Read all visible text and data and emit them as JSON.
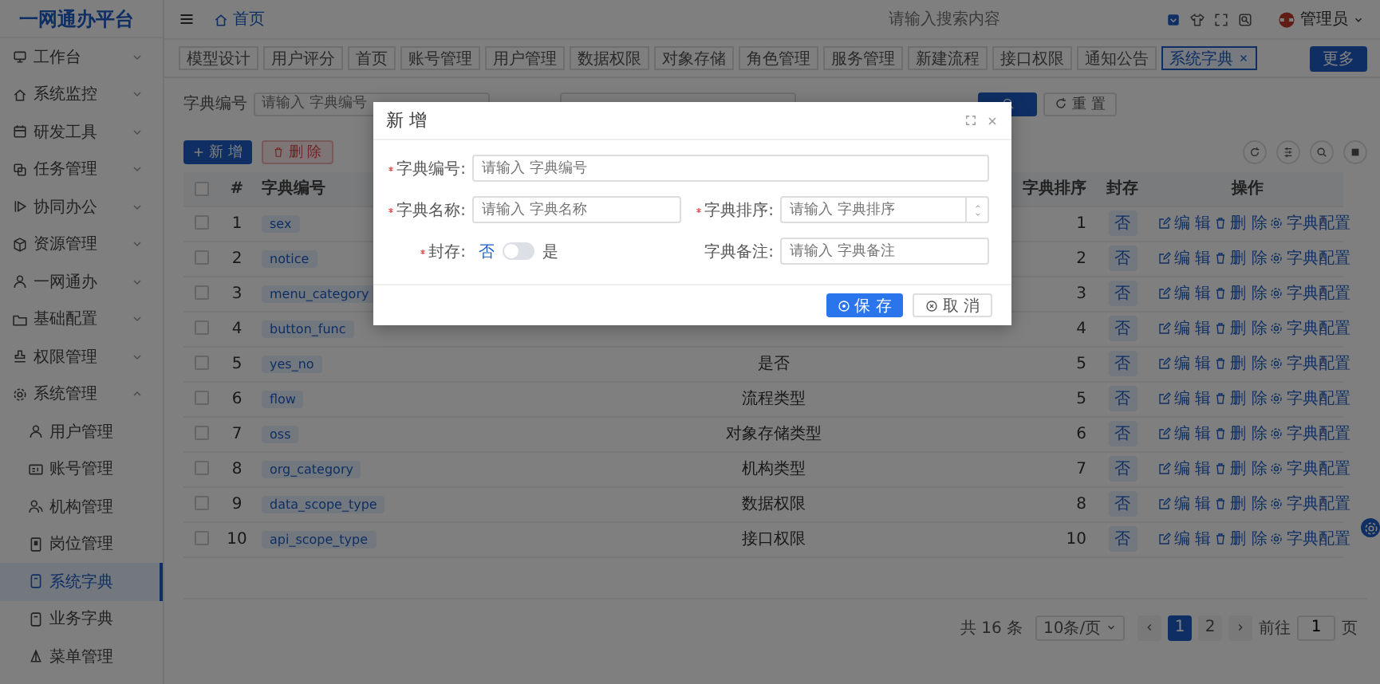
{
  "sidebar": {
    "logo": "一网通办平台",
    "items": [
      {
        "label": "工作台",
        "expanded": false
      },
      {
        "label": "系统监控",
        "expanded": false
      },
      {
        "label": "研发工具",
        "expanded": false
      },
      {
        "label": "任务管理",
        "expanded": false
      },
      {
        "label": "协同办公",
        "expanded": false
      },
      {
        "label": "资源管理",
        "expanded": false
      },
      {
        "label": "一网通办",
        "expanded": false
      },
      {
        "label": "基础配置",
        "expanded": false
      },
      {
        "label": "权限管理",
        "expanded": false
      },
      {
        "label": "系统管理",
        "expanded": true,
        "children": [
          {
            "label": "用户管理",
            "selected": false
          },
          {
            "label": "账号管理",
            "selected": false
          },
          {
            "label": "机构管理",
            "selected": false
          },
          {
            "label": "岗位管理",
            "selected": false
          },
          {
            "label": "系统字典",
            "selected": true
          },
          {
            "label": "业务字典",
            "selected": false
          },
          {
            "label": "菜单管理",
            "selected": false
          }
        ]
      }
    ]
  },
  "header": {
    "breadcrumb": "首页",
    "search": {
      "placeholder": "请输入搜索内容"
    },
    "user": "管理员"
  },
  "tabs": [
    {
      "label": "模型设计",
      "selected": false
    },
    {
      "label": "用户评分",
      "selected": false
    },
    {
      "label": "首页",
      "selected": false
    },
    {
      "label": "账号管理",
      "selected": false
    },
    {
      "label": "用户管理",
      "selected": false
    },
    {
      "label": "数据权限",
      "selected": false
    },
    {
      "label": "对象存储",
      "selected": false
    },
    {
      "label": "角色管理",
      "selected": false
    },
    {
      "label": "服务管理",
      "selected": false
    },
    {
      "label": "新建流程",
      "selected": false
    },
    {
      "label": "接口权限",
      "selected": false
    },
    {
      "label": "通知公告",
      "selected": false
    },
    {
      "label": "系统字典",
      "selected": true
    }
  ],
  "more_button": "更多",
  "search_form": {
    "fields": [
      {
        "label": "字典编号",
        "placeholder": "请输入 字典编号"
      }
    ],
    "reset_button": "重 置"
  },
  "toolbar": {
    "add_button": "新 增",
    "delete_button": "删 除"
  },
  "table": {
    "all_checked": false,
    "columns": {
      "index": "#",
      "code": "字典编号",
      "sort": "字典排序",
      "sealed": "封存",
      "actions": "操作"
    },
    "rows": [
      {
        "index": "1",
        "checked": false,
        "code": "sex",
        "sort": "1",
        "sealed": "否",
        "actions": [
          "编 辑",
          "删 除",
          "字典配置"
        ]
      },
      {
        "index": "2",
        "checked": false,
        "code": "notice",
        "sort": "2",
        "sealed": "否",
        "actions": [
          "编 辑",
          "删 除",
          "字典配置"
        ]
      },
      {
        "index": "3",
        "checked": false,
        "code": "menu_category",
        "sort": "3",
        "sealed": "否",
        "actions": [
          "编 辑",
          "删 除",
          "字典配置"
        ]
      },
      {
        "index": "4",
        "checked": false,
        "code": "button_func",
        "sort": "4",
        "sealed": "否",
        "actions": [
          "编 辑",
          "删 除",
          "字典配置"
        ]
      },
      {
        "index": "5",
        "checked": false,
        "code": "yes_no",
        "name": "是否",
        "sort": "5",
        "sealed": "否",
        "actions": [
          "编 辑",
          "删 除",
          "字典配置"
        ]
      },
      {
        "index": "6",
        "checked": false,
        "code": "flow",
        "name": "流程类型",
        "sort": "5",
        "sealed": "否",
        "actions": [
          "编 辑",
          "删 除",
          "字典配置"
        ]
      },
      {
        "index": "7",
        "checked": false,
        "code": "oss",
        "name": "对象存储类型",
        "sort": "6",
        "sealed": "否",
        "actions": [
          "编 辑",
          "删 除",
          "字典配置"
        ]
      },
      {
        "index": "8",
        "checked": false,
        "code": "org_category",
        "name": "机构类型",
        "sort": "7",
        "sealed": "否",
        "actions": [
          "编 辑",
          "删 除",
          "字典配置"
        ]
      },
      {
        "index": "9",
        "checked": false,
        "code": "data_scope_type",
        "name": "数据权限",
        "sort": "8",
        "sealed": "否",
        "actions": [
          "编 辑",
          "删 除",
          "字典配置"
        ]
      },
      {
        "index": "10",
        "checked": false,
        "code": "api_scope_type",
        "name": "接口权限",
        "sort": "10",
        "sealed": "否",
        "actions": [
          "编 辑",
          "删 除",
          "字典配置"
        ]
      }
    ]
  },
  "pagination": {
    "total": "共 16 条",
    "page_size": "10条/页",
    "pages": [
      {
        "label": "1",
        "selected": true
      },
      {
        "label": "2",
        "selected": false
      }
    ],
    "goto_label": "前往",
    "goto_value": "1",
    "page_suffix": "页"
  },
  "dialog": {
    "title": "新 增",
    "rows": [
      [
        {
          "kind": "text",
          "label": "字典编号:",
          "required": true,
          "placeholder": "请输入 字典编号"
        }
      ],
      [
        {
          "kind": "text",
          "label": "字典名称:",
          "required": true,
          "placeholder": "请输入 字典名称"
        },
        {
          "kind": "number",
          "label": "字典排序:",
          "required": true,
          "placeholder": "请输入 字典排序"
        }
      ],
      [
        {
          "kind": "switch",
          "label": "封存:",
          "required": true,
          "off_label": "否",
          "on_label": "是",
          "on": false
        },
        {
          "kind": "text",
          "label": "字典备注:",
          "required": false,
          "placeholder": "请输入 字典备注"
        }
      ]
    ],
    "save_button": "保 存",
    "cancel_button": "取 消"
  }
}
